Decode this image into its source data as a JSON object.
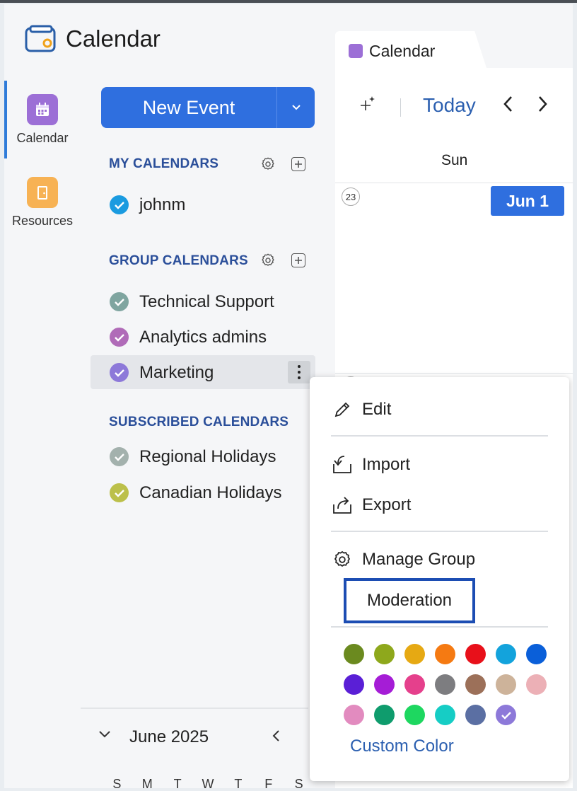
{
  "app": {
    "title": "Calendar",
    "logo_icon": "calendar-app-logo"
  },
  "rail": {
    "items": [
      {
        "label": "Calendar",
        "icon": "calendar-icon",
        "color": "#9c6fd6",
        "active": true
      },
      {
        "label": "Resources",
        "icon": "resources-icon",
        "color": "#f7b254",
        "active": false
      }
    ]
  },
  "sidebar": {
    "new_event_label": "New Event",
    "sections": {
      "my": {
        "title": "MY CALENDARS",
        "items": [
          {
            "name": "johnm",
            "color": "#1a9be0"
          }
        ]
      },
      "group": {
        "title": "GROUP CALENDARS",
        "items": [
          {
            "name": "Technical Support",
            "color": "#7fa5a0"
          },
          {
            "name": "Analytics admins",
            "color": "#b06bb8"
          },
          {
            "name": "Marketing",
            "color": "#8d79d9"
          }
        ]
      },
      "subscribed": {
        "title": "SUBSCRIBED CALENDARS",
        "items": [
          {
            "name": "Regional Holidays",
            "color": "#a3b1ad"
          },
          {
            "name": "Canadian Holidays",
            "color": "#bcc04a"
          }
        ]
      }
    },
    "mini_calendar": {
      "title": "June 2025",
      "weekdays": [
        "S",
        "M",
        "T",
        "W",
        "T",
        "F",
        "S"
      ]
    }
  },
  "main": {
    "tab_label": "Calendar",
    "toolbar": {
      "today_label": "Today"
    },
    "day_header": "Sun",
    "cell": {
      "day_number": "23",
      "badge": "Jun 1"
    }
  },
  "context_menu": {
    "items": {
      "edit": "Edit",
      "import": "Import",
      "export": "Export",
      "manage_group": "Manage Group",
      "moderation": "Moderation"
    },
    "custom_color": "Custom Color",
    "swatches": [
      "#6b8a1f",
      "#8ea81c",
      "#e6a913",
      "#f57a12",
      "#e8101a",
      "#13a3dc",
      "#0a5fd9",
      "#5a1fd6",
      "#a51dd6",
      "#e5408c",
      "#7d7d80",
      "#9c7059",
      "#cdb39a",
      "#ecb0b6",
      "#e28bbf",
      "#0f9c6d",
      "#1ed760",
      "#16cdc5",
      "#5b6fa3",
      "#8d79d9"
    ],
    "selected_swatch": 19
  }
}
